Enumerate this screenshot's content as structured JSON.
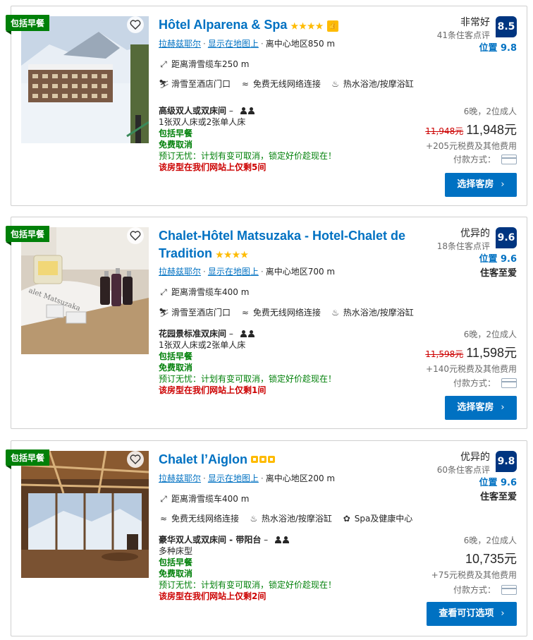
{
  "hotels": [
    {
      "badge": "包括早餐",
      "name": "Hôtel Alparena & Spa",
      "stars": "★★★★",
      "location_city": "拉赫兹耶尔",
      "map_link": "显示在地图上",
      "center_distance": "离中心地区850 m",
      "lift_distance": "距离滑雪缆车250 m",
      "facilities": [
        "滑雪至酒店门口",
        "免费无线网络连接",
        "热水浴池/按摩浴缸"
      ],
      "room_name": "高级双人或双床间",
      "bed": "1张双人床或2张单人床",
      "breakfast": "包括早餐",
      "cancel": "免费取消",
      "promo": "预订无忧：计划有变可取消，锁定好价趁现在！",
      "scarcity": "该房型在我们网站上仅剩5间",
      "review_word": "非常好",
      "review_count": "41条住客点评",
      "score": "8.5",
      "location_score": "位置 9.8",
      "nights": "6晚，2位成人",
      "old_price": "11,948元",
      "price": "11,948元",
      "taxes": "+205元税费及其他费用",
      "payment": "付款方式：",
      "button": "选择客房"
    },
    {
      "badge": "包括早餐",
      "name_line1": "Chalet-Hôtel Matsuzaka - Hotel-Chalet de",
      "name_line2": "Tradition",
      "stars": "★★★★",
      "location_city": "拉赫兹耶尔",
      "map_link": "显示在地图上",
      "center_distance": "离中心地区700 m",
      "lift_distance": "距离滑雪缆车400 m",
      "facilities": [
        "滑雪至酒店门口",
        "免费无线网络连接",
        "热水浴池/按摩浴缸"
      ],
      "room_name": "花园景标准双床间",
      "bed": "1张双人床或2张单人床",
      "breakfast": "包括早餐",
      "cancel": "免费取消",
      "promo": "预订无忧：计划有变可取消，锁定好价趁现在！",
      "scarcity": "该房型在我们网站上仅剩1间",
      "review_word": "优异的",
      "review_count": "18条住客点评",
      "score": "9.6",
      "location_score": "位置 9.6",
      "guest_fav": "住客至爱",
      "nights": "6晚，2位成人",
      "old_price": "11,598元",
      "price": "11,598元",
      "taxes": "+140元税费及其他费用",
      "payment": "付款方式：",
      "button": "选择客房"
    },
    {
      "badge": "包括早餐",
      "name": "Chalet l’Aiglon",
      "location_city": "拉赫兹耶尔",
      "map_link": "显示在地图上",
      "center_distance": "离中心地区200 m",
      "lift_distance": "距离滑雪缆车400 m",
      "facilities": [
        "免费无线网络连接",
        "热水浴池/按摩浴缸",
        "Spa及健康中心"
      ],
      "room_name": "豪华双人或双床间 - 带阳台",
      "bed": "多种床型",
      "breakfast": "包括早餐",
      "cancel": "免费取消",
      "promo": "预订无忧：计划有变可取消，锁定好价趁现在！",
      "scarcity": "该房型在我们网站上仅剩2间",
      "review_word": "优异的",
      "review_count": "60条住客点评",
      "score": "9.8",
      "location_score": "位置 9.6",
      "guest_fav": "住客至爱",
      "nights": "6晚，2位成人",
      "price": "10,735元",
      "taxes": "+75元税费及其他费用",
      "payment": "付款方式：",
      "button": "查看可订选项"
    }
  ],
  "colors": {
    "link": "#0071c2",
    "score_bg": "#003580",
    "green": "#008009",
    "red": "#cc0000",
    "star": "#febb02"
  }
}
